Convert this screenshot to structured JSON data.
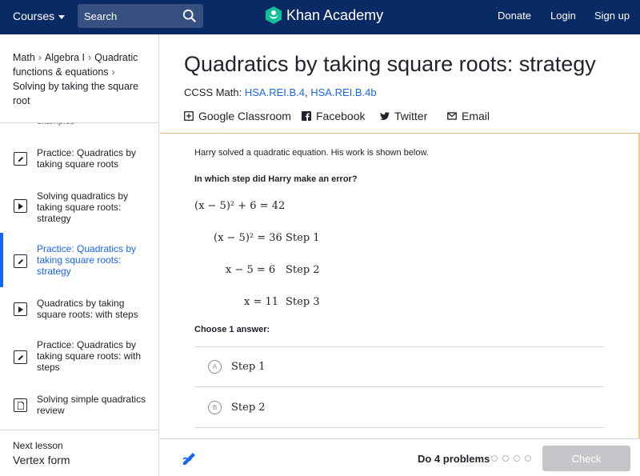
{
  "topbar": {
    "courses_label": "Courses",
    "search_placeholder": "Search",
    "brand_name": "Khan Academy",
    "donate_label": "Donate",
    "login_label": "Login",
    "signup_label": "Sign up",
    "bg_color": "#0a2a66"
  },
  "breadcrumb": {
    "items": [
      "Math",
      "Algebra I",
      "Quadratic functions & equations",
      "Solving by taking the square root"
    ]
  },
  "sidebar": {
    "partial_item": "examples",
    "items": [
      {
        "label": "Practice: Quadratics by taking square roots",
        "icon": "pencil-icon",
        "active": false
      },
      {
        "label": "Solving quadratics by taking square roots: strategy",
        "icon": "play-icon",
        "active": false
      },
      {
        "label": "Practice: Quadratics by taking square roots: strategy",
        "icon": "pencil-icon",
        "active": true
      },
      {
        "label": "Quadratics by taking square roots: with steps",
        "icon": "play-icon",
        "active": false
      },
      {
        "label": "Practice: Quadratics by taking square roots: with steps",
        "icon": "pencil-icon",
        "active": false
      },
      {
        "label": "Solving simple quadratics review",
        "icon": "article-icon",
        "active": false
      }
    ],
    "next_lesson_label": "Next lesson",
    "next_lesson_title": "Vertex form"
  },
  "header": {
    "title": "Quadratics by taking square roots: strategy",
    "ccss_prefix": "CCSS Math:",
    "ccss_links": [
      "HSA.REI.B.4",
      "HSA.REI.B.4b"
    ],
    "share": {
      "classroom": "Google Classroom",
      "facebook": "Facebook",
      "twitter": "Twitter",
      "email": "Email"
    }
  },
  "exercise": {
    "prompt": "Harry solved a quadratic equation. His work is shown below.",
    "question": "In which step did Harry make an error?",
    "steps": [
      {
        "label": "",
        "equation": "(x − 5)² + 6 = 42"
      },
      {
        "label": "Step 1",
        "equation": "(x − 5)² = 36"
      },
      {
        "label": "Step 2",
        "equation": "x − 5 = 6"
      },
      {
        "label": "Step 3",
        "equation": "x = 11"
      }
    ],
    "choose_label": "Choose 1 answer:",
    "options": [
      {
        "letter": "A",
        "text": "Step 1"
      },
      {
        "letter": "B",
        "text": "Step 2"
      }
    ]
  },
  "footer": {
    "do_label": "Do 4 problems",
    "problem_count": 4,
    "check_label": "Check"
  },
  "colors": {
    "accent": "#1865f2",
    "exercise_border": "#f2c98e",
    "check_disabled": "#c4c6ca"
  }
}
